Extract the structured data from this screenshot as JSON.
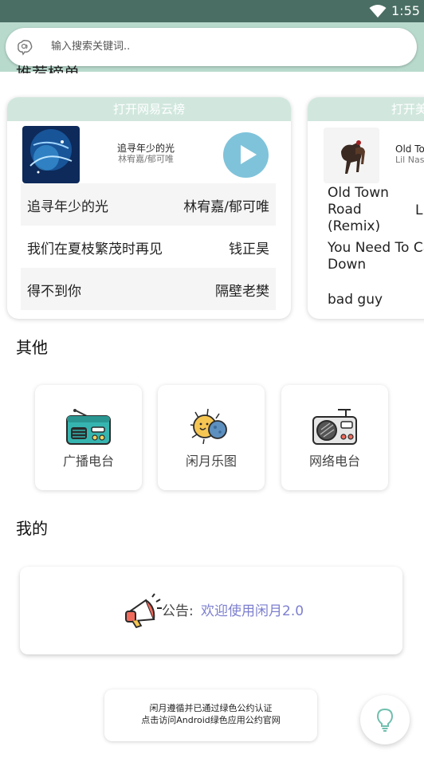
{
  "status_bar": {
    "time": "1:55"
  },
  "search": {
    "placeholder": "输入搜索关键词.."
  },
  "sections": {
    "rank_partial": "推荐榜单",
    "other": "其他",
    "mine": "我的"
  },
  "rank_cards": [
    {
      "header": "打开网易云榜",
      "now_playing": {
        "title": "追寻年少的光",
        "artist": "林宥嘉/郁可唯"
      },
      "songs": [
        {
          "name": "追寻年少的光",
          "artist": "林宥嘉/郁可唯"
        },
        {
          "name": "我们在夏枝繁茂时再见",
          "artist": "钱正昊"
        },
        {
          "name": "得不到你",
          "artist": "隔壁老樊"
        }
      ]
    },
    {
      "header": "打开美",
      "now_playing": {
        "title": "Old To",
        "artist": "Lil Nas"
      },
      "songs": [
        {
          "name_lines": [
            "Old Town",
            "Road",
            "(Remix)"
          ],
          "artist": "L"
        },
        {
          "name_lines": [
            "You Need To Ca",
            "Down"
          ]
        },
        {
          "name_lines": [
            "bad guy"
          ]
        }
      ]
    }
  ],
  "other_tiles": [
    {
      "label": "广播电台",
      "icon": "radio-icon"
    },
    {
      "label": "闲月乐图",
      "icon": "sun-moon-icon"
    },
    {
      "label": "网络电台",
      "icon": "network-radio-icon"
    }
  ],
  "notice": {
    "prefix": "公告:",
    "message": "欢迎使用闲月2.0",
    "icon": "megaphone-icon"
  },
  "footer": {
    "line1": "闲月遵循并已通过绿色公约认证",
    "line2": "点击访问Android绿色应用公约官网"
  },
  "fab": {
    "icon": "lightbulb-icon"
  },
  "colors": {
    "status_bar": "#4a6e63",
    "app_bar": "#b8dacd",
    "card_header": "#d1e7de",
    "play_button": "#7fc3da",
    "notice_link": "#7d7fcf"
  }
}
